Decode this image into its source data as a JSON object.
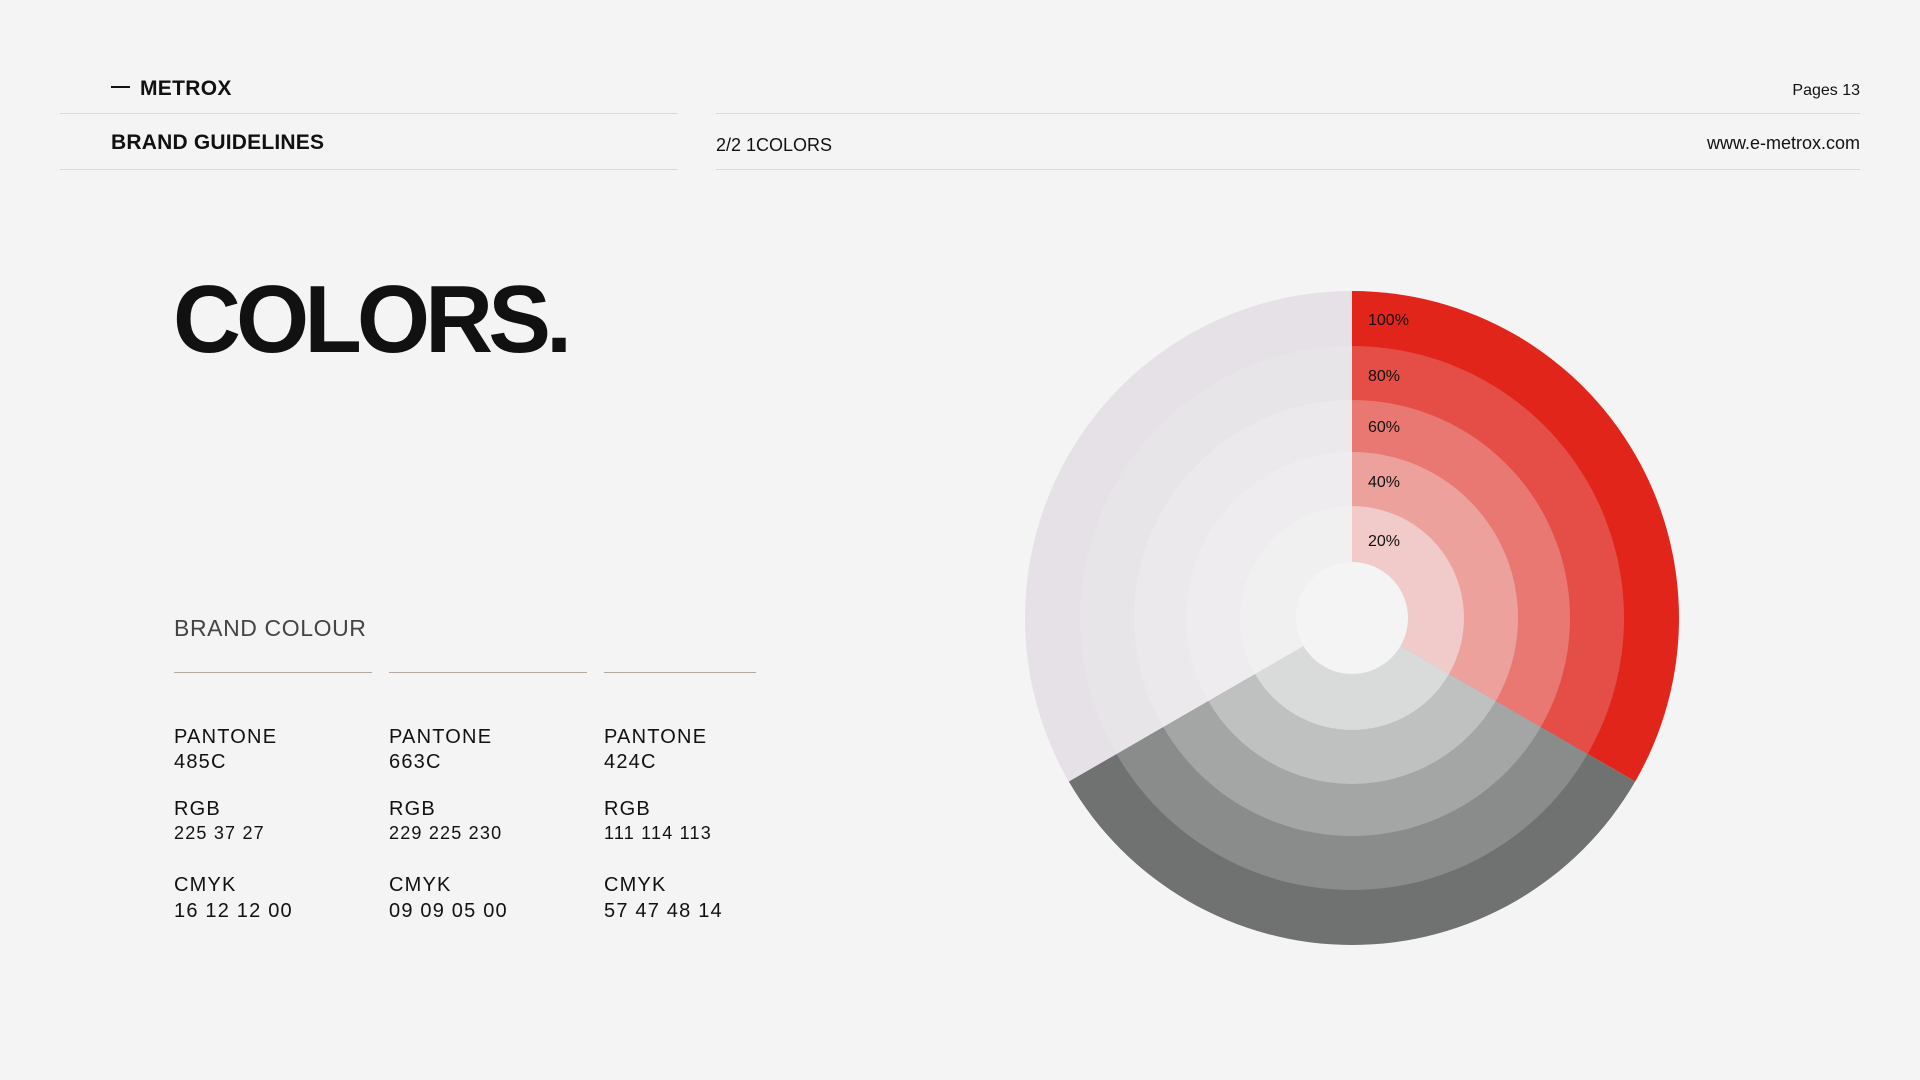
{
  "header": {
    "brand": "METROX",
    "pages": "Pages 13",
    "subtitle": "BRAND GUIDELINES",
    "section": "2/2 1COLORS",
    "website": "www.e-metrox.com"
  },
  "title": "COLORS.",
  "brand_colour_label": "BRAND COLOUR",
  "swatches": [
    {
      "pantone_label": "PANTONE",
      "pantone": "485C",
      "rgb_label": "RGB",
      "rgb": "225 37 27",
      "cmyk_label": "CMYK",
      "cmyk": "16 12 12 00"
    },
    {
      "pantone_label": "PANTONE",
      "pantone": "663C",
      "rgb_label": "RGB",
      "rgb": "229 225 230",
      "cmyk_label": "CMYK",
      "cmyk": "09 09 05 00"
    },
    {
      "pantone_label": "PANTONE",
      "pantone": "424C",
      "rgb_label": "RGB",
      "rgb": "111 114 113",
      "cmyk_label": "CMYK",
      "cmyk": "57 47 48 14"
    }
  ],
  "colors": {
    "red": "#e1251b",
    "light": "#e5e1e6",
    "gray": "#6f7271"
  },
  "chart_data": {
    "type": "pie",
    "rings": [
      {
        "label": "100%",
        "tint": 1.0
      },
      {
        "label": "80%",
        "tint": 0.8
      },
      {
        "label": "60%",
        "tint": 0.6
      },
      {
        "label": "40%",
        "tint": 0.4
      },
      {
        "label": "20%",
        "tint": 0.2
      }
    ],
    "segments": [
      {
        "color_key": "red",
        "start_deg": 0,
        "end_deg": 120
      },
      {
        "color_key": "gray",
        "start_deg": 120,
        "end_deg": 240
      },
      {
        "color_key": "light",
        "start_deg": 240,
        "end_deg": 360
      }
    ]
  }
}
